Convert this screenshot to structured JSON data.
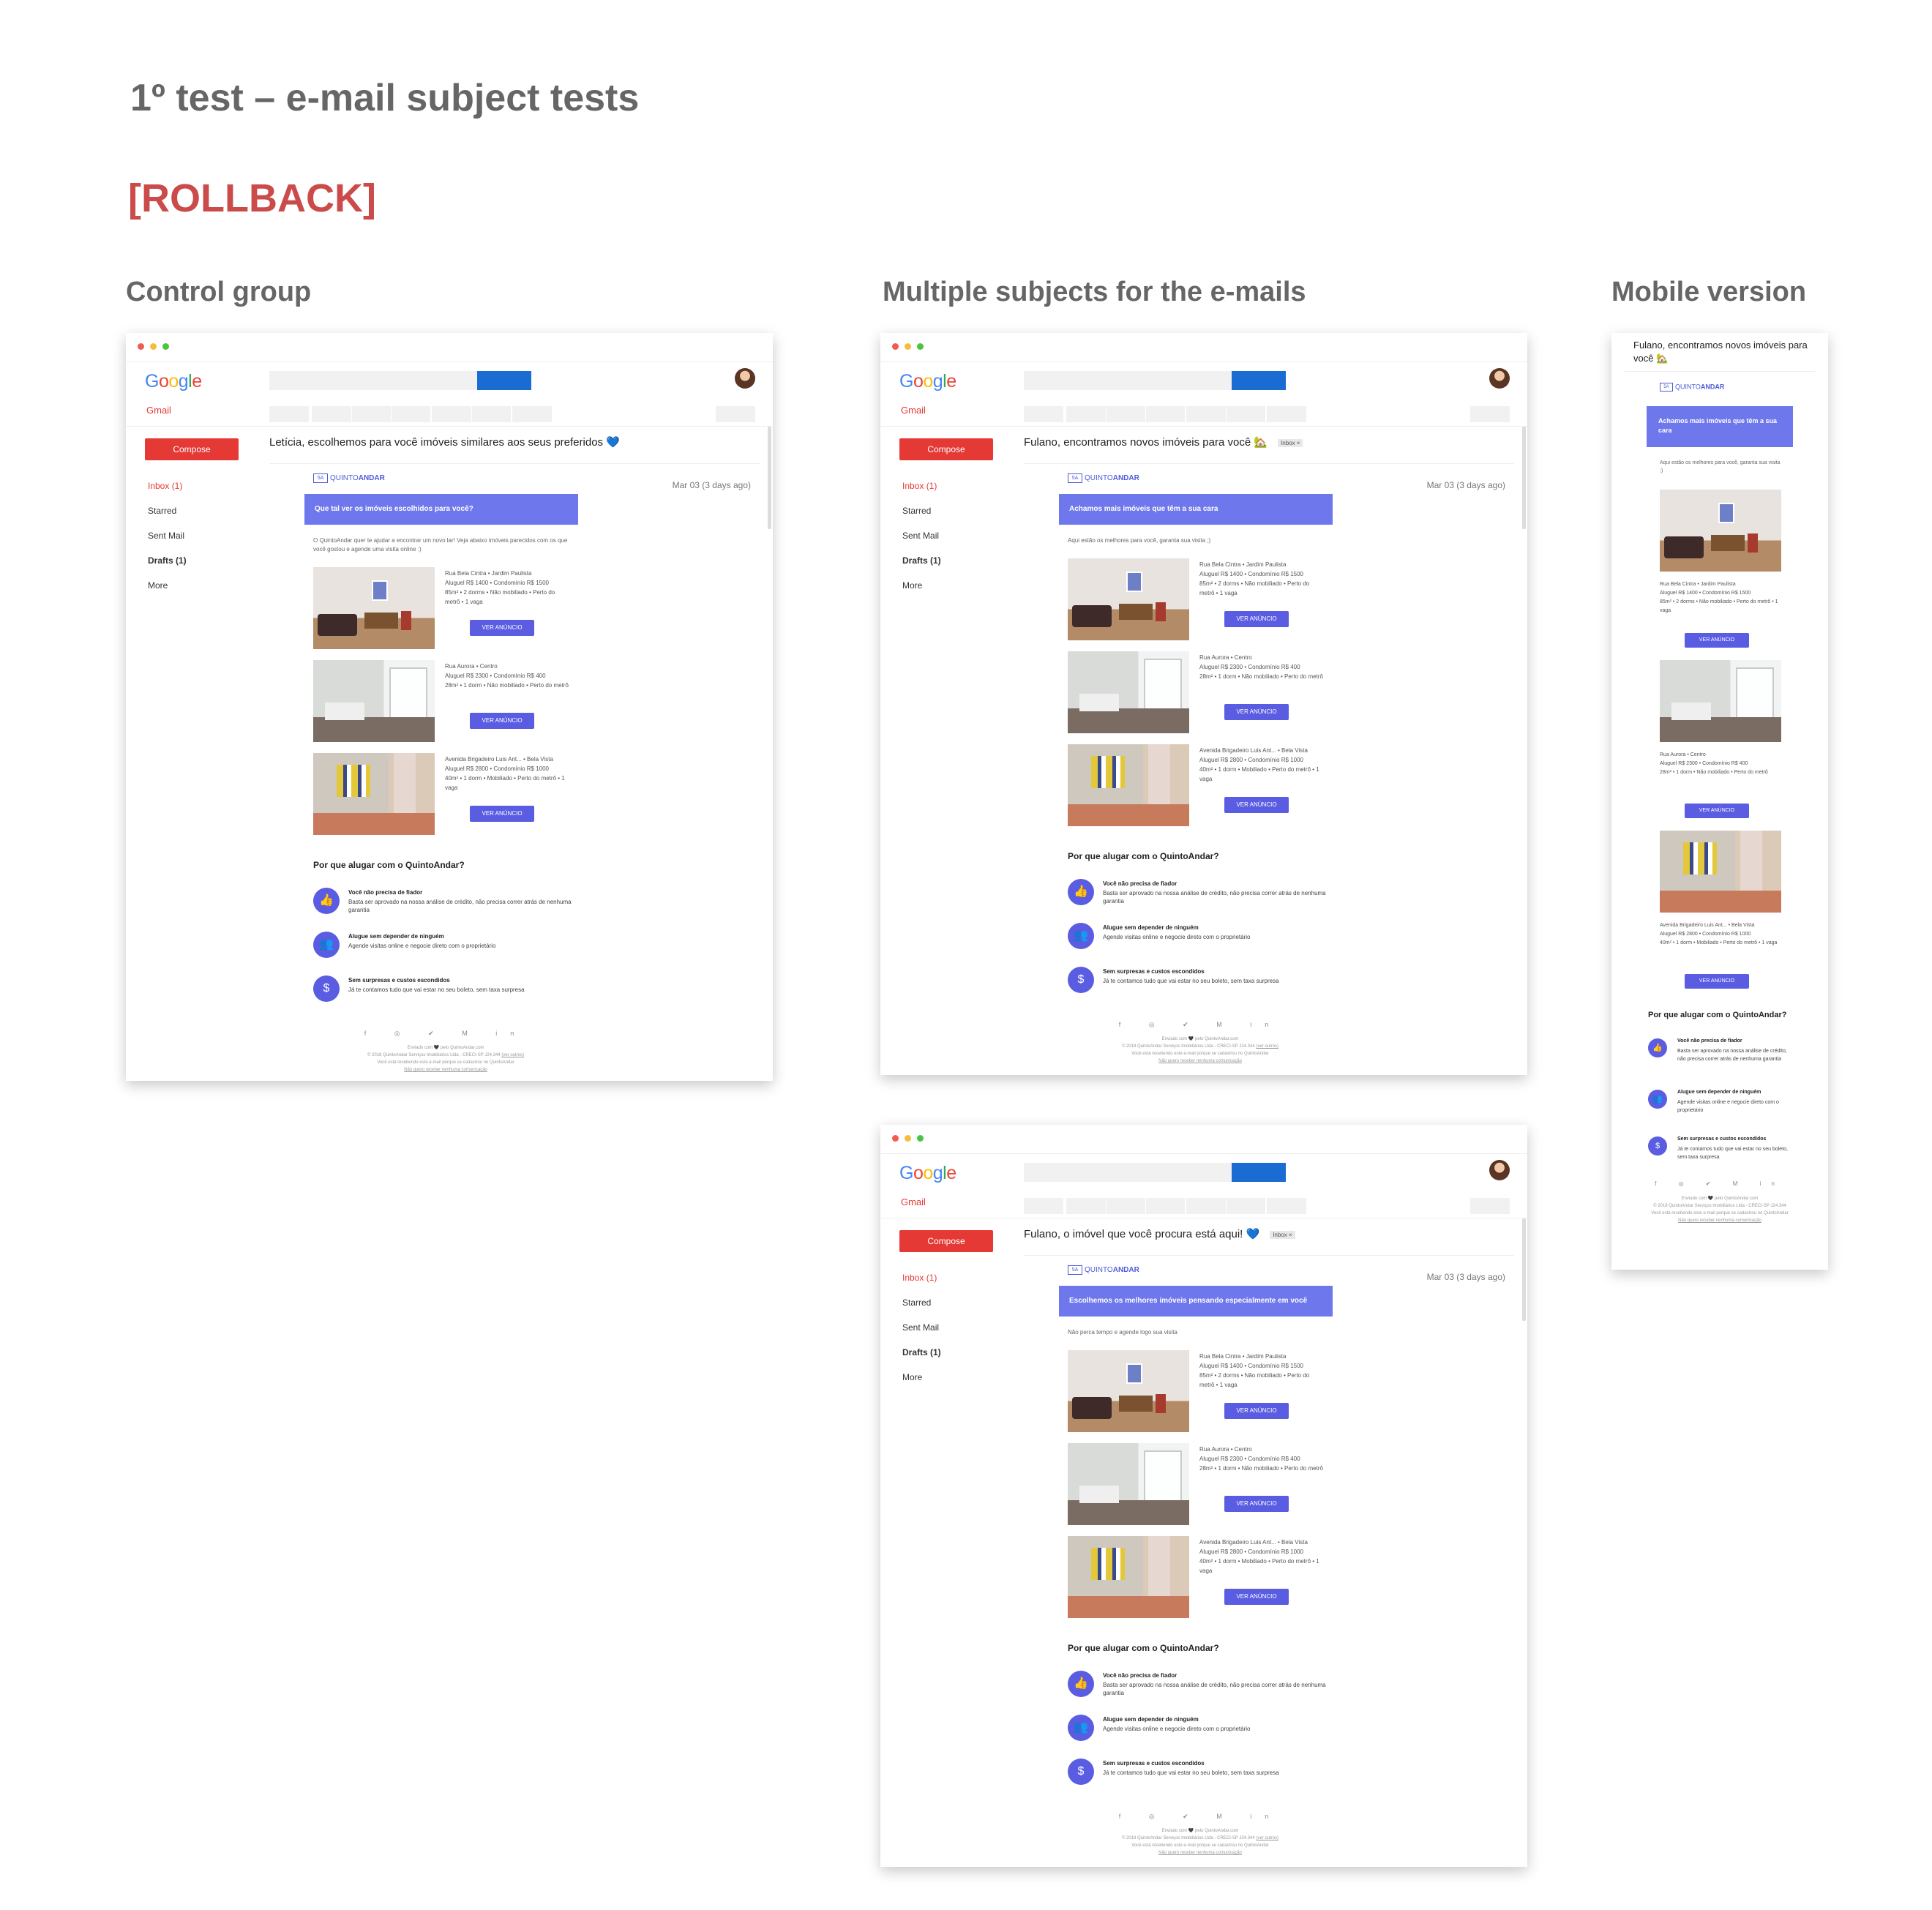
{
  "page": {
    "title": "1º test – e-mail subject tests",
    "status": "[ROLLBACK]"
  },
  "sections": {
    "control": "Control group",
    "multiple": "Multiple subjects for the e-mails",
    "mobile": "Mobile version"
  },
  "gmail": {
    "logo": "Google",
    "app_label": "Gmail",
    "compose": "Compose",
    "nav": [
      "Inbox (1)",
      "Starred",
      "Sent Mail",
      "Drafts (1)",
      "More"
    ],
    "date": "Mar 03 (3 days ago)",
    "inbox_tag": "Inbox ×"
  },
  "brand": {
    "logo_box": "5A",
    "logo_quinto": "QUINTO",
    "logo_andar": "ANDAR"
  },
  "emails": [
    {
      "subject": "Letícia, escolhemos para você imóveis similares aos seus preferidos 💙",
      "banner": "Que tal ver os imóveis escolhidos para você?",
      "intro": "O QuintoAndar quer te ajudar a encontrar um novo lar! Veja abaixo imóveis parecidos com os que você gostou e agende uma visita online :)"
    },
    {
      "subject": "Fulano, encontramos novos imóveis para você 🏡",
      "banner": "Achamos mais imóveis que têm a sua cara",
      "intro": "Aqui estão os melhores para você, garanta sua visita ;)"
    },
    {
      "subject": "Fulano, o imóvel que você procura está aqui! 💙",
      "banner": "Escolhemos os melhores imóveis pensando especialmente em você",
      "intro": "Não perca tempo e agende logo sua visita"
    }
  ],
  "properties": [
    {
      "address": "Rua Bela Cintra • Jardim Paulista",
      "price": "Aluguel R$ 1400 • Condomínio R$ 1500",
      "details": "85m² • 2 dorms • Não mobiliado • Perto do metrô • 1 vaga",
      "button": "VER ANÚNCIO"
    },
    {
      "address": "Rua Aurora • Centro",
      "price": "Aluguel R$ 2300 • Condomínio R$ 400",
      "details": "28m² • 1 dorm • Não mobiliado • Perto do metrô",
      "button": "VER ANÚNCIO"
    },
    {
      "address": "Avenida Brigadeiro Luis Ant... • Bela Vista",
      "price": "Aluguel R$ 2800 • Condomínio R$ 1000",
      "details": "40m² • 1 dorm • Mobiliado • Perto do metrô • 1 vaga",
      "button": "VER ANÚNCIO"
    }
  ],
  "why": {
    "title": "Por que alugar com o QuintoAndar?",
    "items": [
      {
        "icon": "thumbs-up-icon",
        "title": "Você não precisa de fiador",
        "desc": "Basta ser aprovado na nossa análise de crédito, não precisa correr atrás de nenhuma garantia"
      },
      {
        "icon": "people-icon",
        "title": "Alugue sem depender de ninguém",
        "desc": "Agende visitas online e negocie direto com o proprietário"
      },
      {
        "icon": "screen-dollar-icon",
        "title": "Sem surpresas e custos escondidos",
        "desc": "Já te contamos tudo que vai estar no seu boleto, sem taxa surpresa"
      }
    ]
  },
  "footer": {
    "social": "f ◎ ✔ M in",
    "sent": "Enviado com 🖤 pelo QuintoAndar.com",
    "legal": "© 2018 QuintoAndar Serviços Imobiliários Ltda - CRECI-SP J24.344",
    "legal_link": "(ver outros)",
    "reason": "Você está recebendo este e-mail porque se cadastrou no QuintoAndar",
    "unsubscribe": "Não quero receber nenhuma comunicação"
  },
  "mobile": {
    "subject": "Fulano, encontramos novos imóveis para você 🏡",
    "banner": "Achamos mais imóveis que têm a sua cara",
    "intro": "Aqui estão os melhores para você, garanta sua visita ;)",
    "footer_legal": "© 2018 QuintoAndar Serviços Imobiliários Ltda - CRECI-SP J24.344",
    "footer_reason": "Você está recebendo este e-mail porque se cadastrou no QuintoAndar"
  }
}
